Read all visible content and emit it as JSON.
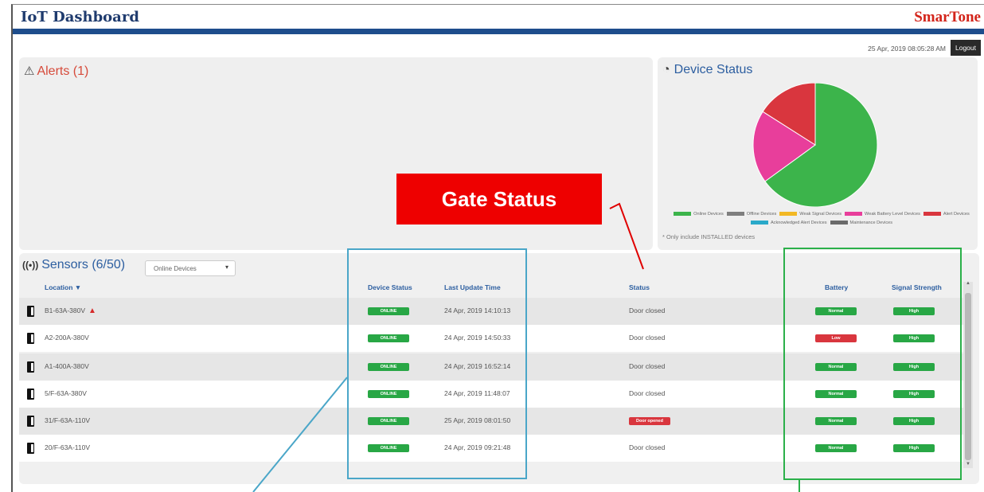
{
  "header": {
    "app_title": "IoT Dashboard",
    "brand": "SmarTone",
    "datetime": "25 Apr, 2019 08:05:28 AM",
    "logout_label": "Logout"
  },
  "alerts": {
    "title": "Alerts (1)"
  },
  "device_status": {
    "title": "Device Status",
    "note": "* Only include INSTALLED devices",
    "legend": [
      {
        "label": "Online Devices",
        "color": "#3cb44b"
      },
      {
        "label": "Offline Devices",
        "color": "#7f7f7f"
      },
      {
        "label": "Weak Signal Devices",
        "color": "#f2b824"
      },
      {
        "label": "Weak Battery Level Devices",
        "color": "#e83e9b"
      },
      {
        "label": "Alert Devices",
        "color": "#d9363e"
      },
      {
        "label": "Acknowledged Alert Devices",
        "color": "#2aa9c9"
      },
      {
        "label": "Maintenance Devices",
        "color": "#6b6b6b"
      }
    ],
    "pie": [
      {
        "label": "Online Devices",
        "value": 65,
        "color": "#3cb44b"
      },
      {
        "label": "Weak Battery Level Devices",
        "value": 19,
        "color": "#e83e9b"
      },
      {
        "label": "Alert Devices",
        "value": 16,
        "color": "#d9363e"
      }
    ]
  },
  "sensors": {
    "title": "Sensors (6/50)",
    "filter_value": "Online Devices",
    "columns": {
      "location": "Location",
      "device_status": "Device Status",
      "last_update": "Last Update Time",
      "status": "Status",
      "battery": "Battery",
      "signal": "Signal Strength"
    },
    "rows": [
      {
        "location": "B1-63A-380V",
        "alert": "▲",
        "device_status": "ONLINE",
        "last_update": "24 Apr, 2019 14:10:13",
        "status": "Door closed",
        "battery": "Normal",
        "signal": "High"
      },
      {
        "location": "A2-200A-380V",
        "alert": "",
        "device_status": "ONLINE",
        "last_update": "24 Apr, 2019 14:50:33",
        "status": "Door closed",
        "battery": "Low",
        "signal": "High"
      },
      {
        "location": "A1-400A-380V",
        "alert": "",
        "device_status": "ONLINE",
        "last_update": "24 Apr, 2019 16:52:14",
        "status": "Door closed",
        "battery": "Normal",
        "signal": "High"
      },
      {
        "location": "5/F-63A-380V",
        "alert": "",
        "device_status": "ONLINE",
        "last_update": "24 Apr, 2019 11:48:07",
        "status": "Door closed",
        "battery": "Normal",
        "signal": "High"
      },
      {
        "location": "31/F-63A-110V",
        "alert": "",
        "device_status": "ONLINE",
        "last_update": "25 Apr, 2019 08:01:50",
        "status": "Door opened",
        "battery": "Normal",
        "signal": "High"
      },
      {
        "location": "20/F-63A-110V",
        "alert": "",
        "device_status": "ONLINE",
        "last_update": "24 Apr, 2019 09:21:48",
        "status": "Door closed",
        "battery": "Normal",
        "signal": "High"
      }
    ]
  },
  "annotation": {
    "gate_status": "Gate Status"
  },
  "icons": [
    "alert-triangle-icon",
    "pie-chart-icon",
    "antenna-icon",
    "door-icon",
    "sort-down-icon",
    "dropdown-caret-icon"
  ]
}
